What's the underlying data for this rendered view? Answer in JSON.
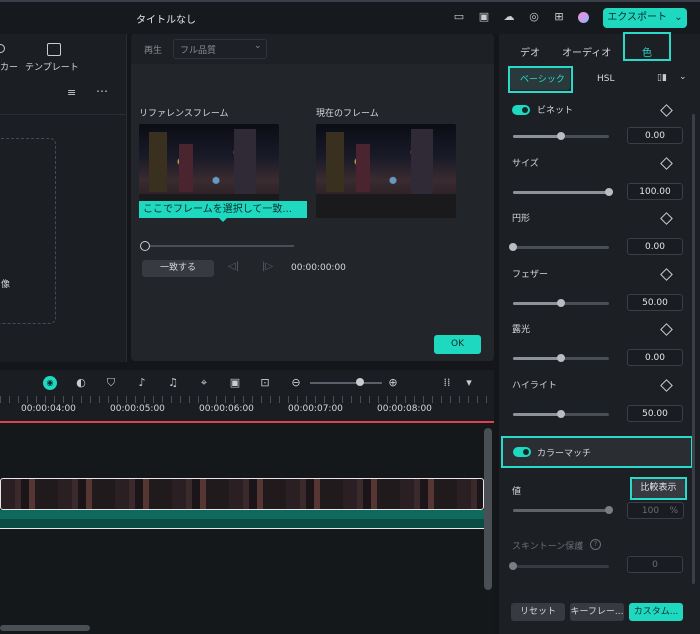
{
  "window": {
    "title": "タイトルなし",
    "export_label": "エクスポート",
    "export_chevron": "⌄"
  },
  "left_panel": {
    "tab_sticker_label": "カー",
    "tab_template_label": "テンプレート",
    "drop_text": "像"
  },
  "dialog": {
    "playback_label": "再生",
    "quality_value": "フル品質",
    "reference_label": "リファレンスフレーム",
    "current_label": "現在のフレーム",
    "callout_text": "ここでフレームを選択して一致...",
    "match_button": "一致する",
    "timecode": "00:00:00:00",
    "ok_button": "OK",
    "slider_value": 0
  },
  "right_panel": {
    "tabs": [
      "デオ",
      "オーディオ",
      "色"
    ],
    "subtabs": {
      "basic": "ベーシック",
      "hsl": "HSL"
    },
    "vignette_label": "ビネット",
    "rows": [
      {
        "label": "",
        "value": "0.00",
        "fraction": 0.5
      },
      {
        "label": "サイズ",
        "value": "100.00",
        "fraction": 1.0
      },
      {
        "label": "円形",
        "value": "0.00",
        "fraction": 0.0
      },
      {
        "label": "フェザー",
        "value": "50.00",
        "fraction": 0.5
      },
      {
        "label": "露光",
        "value": "0.00",
        "fraction": 0.5
      },
      {
        "label": "ハイライト",
        "value": "50.00",
        "fraction": 0.5
      }
    ],
    "color_match_label": "カラーマッチ",
    "value_label": "値",
    "compare_button": "比較表示",
    "value_amount": "100",
    "value_unit": "%",
    "value_fraction": 1.0,
    "skintone_label": "スキントーン保護",
    "skintone_value": "0",
    "skintone_fraction": 0.0,
    "footer": [
      "リセット",
      "キーフレー...",
      "カスタム..."
    ]
  },
  "timeline": {
    "ruler_labels": [
      "00:00:04:00",
      "00:00:05:00",
      "00:00:06:00",
      "00:00:07:00",
      "00:00:08:00"
    ],
    "zoom_fraction": 0.7
  },
  "colors": {
    "accent": "#1fd8c0",
    "highlight": "#29d9ca",
    "playhead": "#e0424a"
  }
}
